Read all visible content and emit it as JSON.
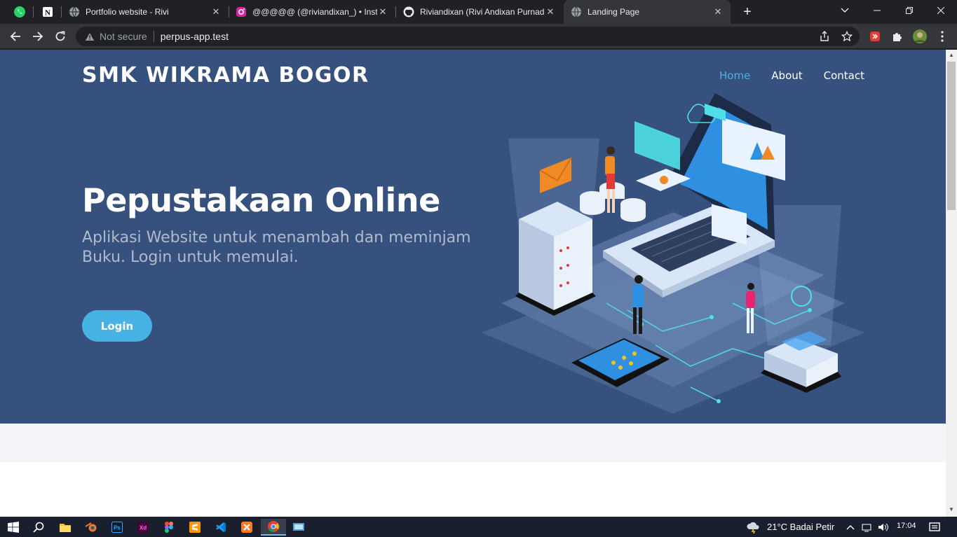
{
  "browser": {
    "tabs": [
      {
        "title": "Portfolio website - Rivi"
      },
      {
        "title": "@@@@@ (@riviandixan_) • Instag"
      },
      {
        "title": "Riviandixan (Rivi Andixan Purnad"
      },
      {
        "title": "Landing Page"
      }
    ],
    "security_label": "Not secure",
    "url": "perpus-app.test"
  },
  "site": {
    "brand": "SMK WIKRAMA BOGOR",
    "nav": [
      "Home",
      "About",
      "Contact"
    ],
    "active_nav": "Home",
    "headline": "Pepustakaan Online",
    "subline": "Aplikasi Website untuk menambah dan meminjam Buku. Login untuk memulai.",
    "login_label": "Login"
  },
  "taskbar": {
    "weather": "21°C  Badai Petir",
    "time": "17:04"
  },
  "colors": {
    "hero_bg": "#37517e",
    "accent": "#47b2e4",
    "band_bg": "#f3f5fa"
  }
}
